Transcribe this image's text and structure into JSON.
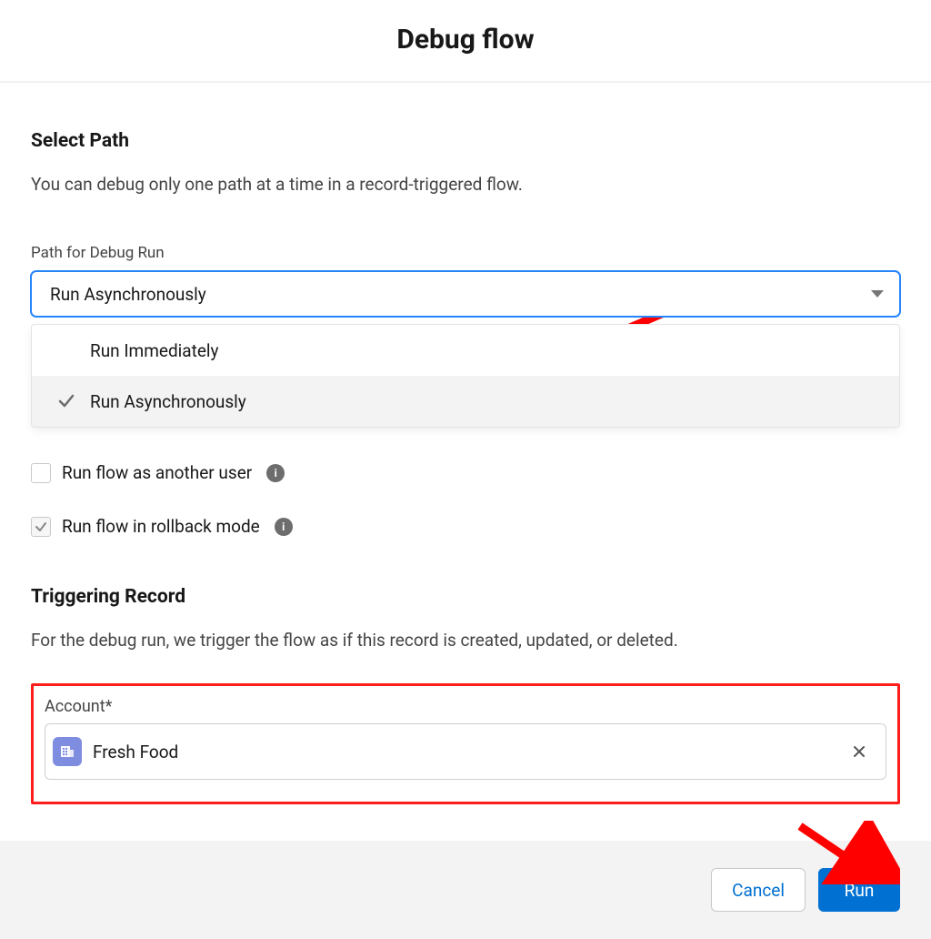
{
  "title": "Debug flow",
  "selectPath": {
    "heading": "Select Path",
    "description": "You can debug only one path at a time in a record-triggered flow.",
    "fieldLabel": "Path for Debug Run",
    "selectedValue": "Run Asynchronously",
    "options": {
      "0": {
        "label": "Run Immediately",
        "selected": false
      },
      "1": {
        "label": "Run Asynchronously",
        "selected": true
      }
    }
  },
  "runAsUser": {
    "label": "Run flow as another user",
    "checked": false
  },
  "rollback": {
    "label": "Run flow in rollback mode",
    "checked": true
  },
  "triggering": {
    "heading": "Triggering Record",
    "description": "For the debug run, we trigger the flow as if this record is created, updated, or deleted.",
    "accountLabel": "Account*",
    "recordName": "Fresh Food"
  },
  "footer": {
    "cancel": "Cancel",
    "run": "Run"
  }
}
